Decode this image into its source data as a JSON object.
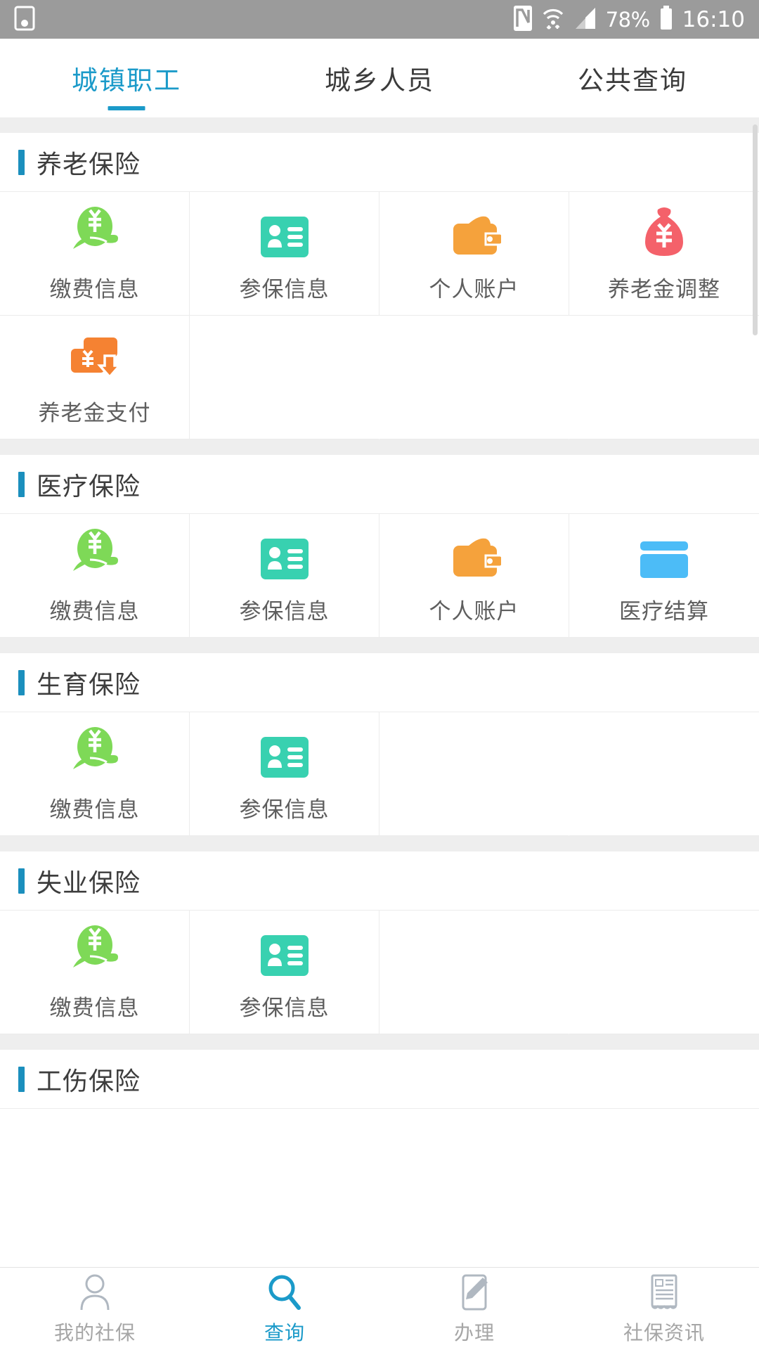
{
  "status_bar": {
    "left_icons": [
      "screen-record-icon"
    ],
    "nfc_icon": "nfc-icon",
    "wifi_icon": "wifi-icon",
    "signal_icon": "cellular-signal-icon",
    "battery_percent": "78%",
    "battery_icon": "battery-icon",
    "clock": "16:10"
  },
  "tabs": [
    {
      "label": "城镇职工",
      "active": true
    },
    {
      "label": "城乡人员",
      "active": false
    },
    {
      "label": "公共查询",
      "active": false
    }
  ],
  "accent_color": "#1b9ac9",
  "section_bar_color": "#1b8fbd",
  "sections": [
    {
      "title": "养老保险",
      "items": [
        {
          "label": "缴费信息",
          "icon": "hand-yuan-icon",
          "color": "#7ed957"
        },
        {
          "label": "参保信息",
          "icon": "id-card-icon",
          "color": "#38d1b0"
        },
        {
          "label": "个人账户",
          "icon": "wallet-icon",
          "color": "#f5a council"
        },
        {
          "label": "养老金调整",
          "icon": "money-bag-icon",
          "color": "#f4616a"
        },
        {
          "label": "养老金支付",
          "icon": "card-payout-icon",
          "color": "#f58232"
        }
      ]
    },
    {
      "title": "医疗保险",
      "items": [
        {
          "label": "缴费信息",
          "icon": "hand-yuan-icon",
          "color": "#7ed957"
        },
        {
          "label": "参保信息",
          "icon": "id-card-icon",
          "color": "#38d1b0"
        },
        {
          "label": "个人账户",
          "icon": "wallet-icon",
          "color": "#f5a23c"
        },
        {
          "label": "医疗结算",
          "icon": "bank-card-icon",
          "color": "#4cbcf7"
        }
      ]
    },
    {
      "title": "生育保险",
      "items": [
        {
          "label": "缴费信息",
          "icon": "hand-yuan-icon",
          "color": "#7ed957"
        },
        {
          "label": "参保信息",
          "icon": "id-card-icon",
          "color": "#38d1b0"
        }
      ]
    },
    {
      "title": "失业保险",
      "items": [
        {
          "label": "缴费信息",
          "icon": "hand-yuan-icon",
          "color": "#7ed957"
        },
        {
          "label": "参保信息",
          "icon": "id-card-icon",
          "color": "#38d1b0"
        }
      ]
    },
    {
      "title": "工伤保险",
      "items": []
    }
  ],
  "bottom_nav": [
    {
      "label": "我的社保",
      "icon": "user-outline-icon",
      "active": false
    },
    {
      "label": "查询",
      "icon": "search-icon",
      "active": true
    },
    {
      "label": "办理",
      "icon": "pencil-document-icon",
      "active": false
    },
    {
      "label": "社保资讯",
      "icon": "newspaper-icon",
      "active": false
    }
  ]
}
